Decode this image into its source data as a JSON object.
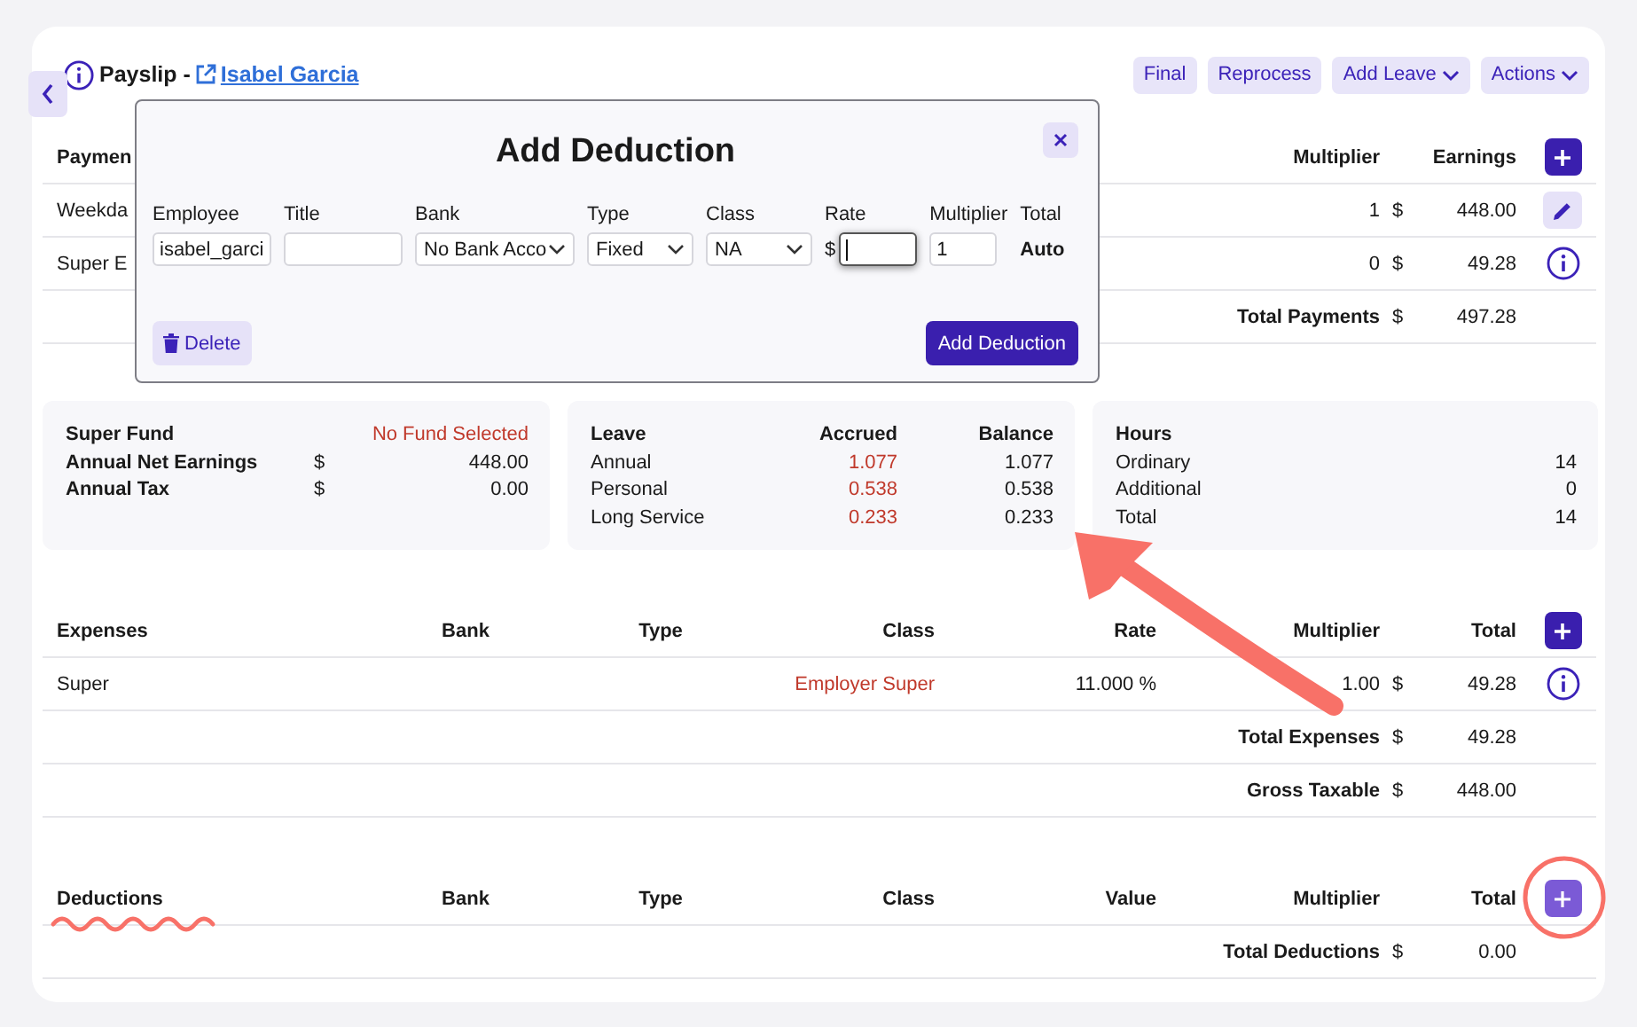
{
  "header": {
    "title": "Payslip -",
    "employee_link": "Isabel Garcia"
  },
  "actions": [
    {
      "label": "Final",
      "kind": "button"
    },
    {
      "label": "Reprocess",
      "kind": "button"
    },
    {
      "label": "Add Leave",
      "kind": "dropdown"
    },
    {
      "label": "Actions",
      "kind": "dropdown"
    }
  ],
  "payments": {
    "heading": "Paymen",
    "multiplier_header": "Multiplier",
    "earnings_header": "Earnings",
    "rows": [
      {
        "name": "Weekda",
        "multiplier": "1",
        "currency": "$",
        "earnings": "448.00",
        "kind": "edit"
      },
      {
        "name": "Super E",
        "multiplier": "0",
        "currency": "$",
        "earnings": "49.28",
        "kind": "info"
      }
    ],
    "total": {
      "label": "Total Payments",
      "currency": "$",
      "value": "497.28"
    }
  },
  "summary": [
    {
      "label": "Super Fund",
      "value": "No Fund Selected",
      "alert": true
    },
    {
      "label": "Annual Net Earnings",
      "currency": "$",
      "value": "448.00",
      "alert": false
    },
    {
      "label": "Annual Tax",
      "currency": "$",
      "value": "0.00",
      "alert": false
    }
  ],
  "leave": {
    "columns": [
      "Leave",
      "Accrued",
      "Balance"
    ],
    "rows": [
      {
        "name": "Annual",
        "accrued": "1.077",
        "balance": "1.077"
      },
      {
        "name": "Personal",
        "accrued": "0.538",
        "balance": "0.538"
      },
      {
        "name": "Long Service",
        "accrued": "0.233",
        "balance": "0.233"
      }
    ]
  },
  "hours": {
    "heading": "Hours",
    "rows": [
      {
        "name": "Ordinary",
        "value": "14"
      },
      {
        "name": "Additional",
        "value": "0"
      },
      {
        "name": "Total",
        "value": "14"
      }
    ]
  },
  "expenses": {
    "columns": [
      "Expenses",
      "Bank",
      "Type",
      "Class",
      "Rate",
      "Multiplier",
      "Total"
    ],
    "rows": [
      {
        "name": "Super",
        "class": "Employer Super",
        "rate": "11.000 %",
        "multiplier": "1.00",
        "currency": "$",
        "total": "49.28",
        "kind": "info"
      }
    ],
    "totals": [
      {
        "label": "Total Expenses",
        "currency": "$",
        "value": "49.28"
      },
      {
        "label": "Gross Taxable",
        "currency": "$",
        "value": "448.00"
      }
    ]
  },
  "deductions": {
    "columns": [
      "Deductions",
      "Bank",
      "Type",
      "Class",
      "Value",
      "Multiplier",
      "Total"
    ],
    "totals": [
      {
        "label": "Total Deductions",
        "currency": "$",
        "value": "0.00"
      }
    ]
  },
  "modal": {
    "title": "Add Deduction",
    "fields": [
      {
        "label": "Employee",
        "kind": "input",
        "value": "isabel_garci"
      },
      {
        "label": "Title",
        "kind": "input"
      },
      {
        "label": "Bank",
        "kind": "select",
        "value": "No Bank Acco"
      },
      {
        "label": "Type",
        "kind": "select",
        "value": "Fixed"
      },
      {
        "label": "Class",
        "kind": "select",
        "value": "NA"
      },
      {
        "label": "Rate",
        "kind": "money",
        "prefix": "$",
        "focused": true
      },
      {
        "label": "Multiplier",
        "kind": "input",
        "value": "1"
      },
      {
        "label": "Total",
        "kind": "static",
        "value": "Auto"
      }
    ],
    "delete_label": "Delete",
    "submit_label": "Add Deduction"
  },
  "annotations": [
    {
      "kind": "arrow"
    },
    {
      "kind": "squiggle"
    },
    {
      "kind": "circle"
    }
  ]
}
